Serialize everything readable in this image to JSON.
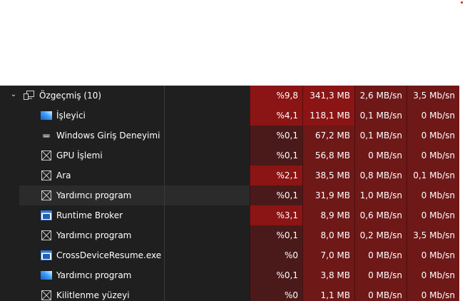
{
  "colors": {
    "heat_high": "#8b1414",
    "heat_mid": "#6e1818",
    "heat_low": "#4a1a1a",
    "text": "#ffffff",
    "bg": "#1f1f1f"
  },
  "group": {
    "label": "Özgeçmiş (10)",
    "icon": "computer-monitor-icon",
    "cpu": "%9,8",
    "memory": "341,3 MB",
    "disk": "2,6 MB/sn",
    "network": "3,5 Mb/sn"
  },
  "rows": [
    {
      "label": "İşleyici",
      "icon": "app-window-blue-icon",
      "cpu": "%4,1",
      "memory": "118,1 MB",
      "disk": "0,1 MB/sn",
      "network": "0 Mb/sn",
      "heat": [
        "high",
        "high",
        "mid",
        "mid"
      ]
    },
    {
      "label": "Windows Giriş Deneyimi",
      "icon": "keyboard-icon",
      "cpu": "%0,1",
      "memory": "67,2 MB",
      "disk": "0,1 MB/sn",
      "network": "0 Mb/sn",
      "heat": [
        "low",
        "mid",
        "mid",
        "mid"
      ]
    },
    {
      "label": "GPU İşlemi",
      "icon": "placeholder-box-icon",
      "cpu": "%0,1",
      "memory": "56,8 MB",
      "disk": "0 MB/sn",
      "network": "0 Mb/sn",
      "heat": [
        "low",
        "mid",
        "mid",
        "mid"
      ]
    },
    {
      "label": "Ara",
      "icon": "placeholder-box-icon",
      "cpu": "%2,1",
      "memory": "38,5 MB",
      "disk": "0,8 MB/sn",
      "network": "0,1 Mb/sn",
      "heat": [
        "high",
        "mid",
        "mid",
        "mid"
      ]
    },
    {
      "label": "Yardımcı program",
      "icon": "placeholder-box-icon",
      "cpu": "%0,1",
      "memory": "31,9 MB",
      "disk": "1,0 MB/sn",
      "network": "0 Mb/sn",
      "heat": [
        "low",
        "mid",
        "mid",
        "mid"
      ],
      "highlight": true
    },
    {
      "label": "Runtime Broker",
      "icon": "app-window-icon",
      "cpu": "%3,1",
      "memory": "8,9 MB",
      "disk": "0,6 MB/sn",
      "network": "0 Mb/sn",
      "heat": [
        "high",
        "mid",
        "mid",
        "mid"
      ]
    },
    {
      "label": "Yardımcı program",
      "icon": "placeholder-box-icon",
      "cpu": "%0,1",
      "memory": "8,0 MB",
      "disk": "0,2 MB/sn",
      "network": "3,5 Mb/sn",
      "heat": [
        "low",
        "mid",
        "mid",
        "mid"
      ]
    },
    {
      "label": "CrossDeviceResume.exe",
      "icon": "app-window-icon",
      "cpu": "%0",
      "memory": "7,0 MB",
      "disk": "0 MB/sn",
      "network": "0 Mb/sn",
      "heat": [
        "low",
        "mid",
        "mid",
        "mid"
      ]
    },
    {
      "label": "Yardımcı program",
      "icon": "app-window-blue-icon",
      "cpu": "%0,1",
      "memory": "3,8 MB",
      "disk": "0 MB/sn",
      "network": "0 Mb/sn",
      "heat": [
        "low",
        "mid",
        "mid",
        "mid"
      ]
    },
    {
      "label": "Kilitlenme yüzeyi",
      "icon": "placeholder-box-icon",
      "cpu": "%0",
      "memory": "1,1 MB",
      "disk": "0 MB/sn",
      "network": "0 Mb/sn",
      "heat": [
        "low",
        "mid",
        "mid",
        "mid"
      ]
    }
  ]
}
